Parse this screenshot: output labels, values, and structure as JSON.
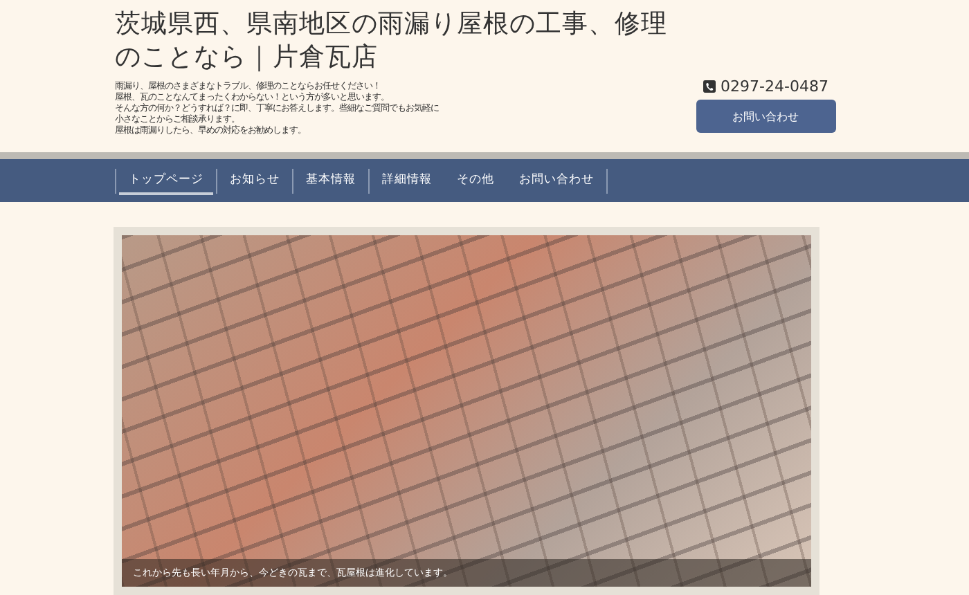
{
  "header": {
    "title": "茨城県西、県南地区の雨漏り屋根の工事、修理のことなら｜片倉瓦店",
    "intro": [
      "雨漏り、屋根のさまざまなトラブル、修理のことならお任せください！",
      "屋根、瓦のことなんてまったくわからない！という方が多いと思います。",
      "そんな方の何か？どうすれば？に即、丁寧にお答えします。些細なご質問でもお気軽に",
      "小さなことからご相談承ります。",
      "屋根は雨漏りしたら、早めの対応をお勧めします。"
    ],
    "phone": "0297-24-0487",
    "contact_button": "お問い合わせ"
  },
  "nav": [
    {
      "label": "トップページ",
      "selected": true
    },
    {
      "label": "お知らせ",
      "selected": false
    },
    {
      "label": "基本情報",
      "selected": false
    },
    {
      "label": "詳細情報",
      "selected": false
    },
    {
      "label": "その他",
      "selected": false
    },
    {
      "label": "お問い合わせ",
      "selected": false
    }
  ],
  "hero": {
    "caption": "これから先も長い年月から、今どきの瓦まで、瓦屋根は進化しています。"
  }
}
